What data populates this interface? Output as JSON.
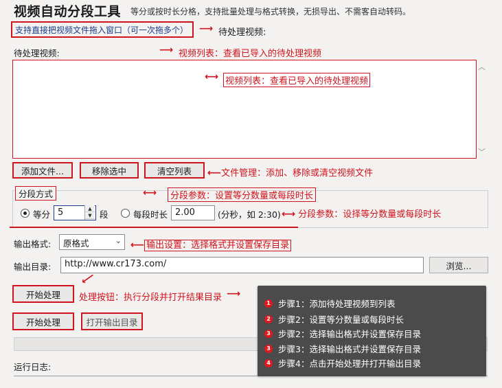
{
  "header": {
    "title": "视频自动分段工具",
    "subtitle": "等分或按时长分格，支持批量处理与格式转换，无损导出、不需客自动转码。"
  },
  "hint": {
    "text": "支持直接把视频文件拖入窗口（可一次拖多个）"
  },
  "annotations": {
    "pending": "待处理视频:",
    "list_top": "视频列表：查看已导入的待处理视频",
    "list_inside": "视频列表：查看已导入的待处理视频",
    "file_mgmt": "文件管理：添加、移除或清空视频文件",
    "split_param_1": "分段参数：设置等分数量或每段时长",
    "split_param_2": "分段参数：设择等分数量或每段时长",
    "output": "输出设置：选择格式并设置保存目录",
    "process": "处理按钮：执行分段并打开结果目录"
  },
  "list": {
    "label": "待处理视频:"
  },
  "file_buttons": {
    "add": "添加文件...",
    "remove": "移除选中",
    "clear": "清空列表"
  },
  "split": {
    "legend": "分段方式",
    "equal_label": "等分",
    "equal_value": "5",
    "equal_unit": "段",
    "duration_label": "每段时长",
    "duration_value": "2.00",
    "duration_hint": "(分秒，如 2:30)"
  },
  "output": {
    "format_label": "输出格式:",
    "format_value": "原格式",
    "dir_label": "输出目录:",
    "dir_value": "http://www.cr173.com/",
    "browse": "浏览..."
  },
  "process": {
    "start": "开始处理",
    "start2": "开始处理",
    "open_dir": "打开输出目录"
  },
  "log": {
    "label": "运行日志:"
  },
  "steps": [
    {
      "n": "1",
      "text": "步骤1：添加待处理视频到列表"
    },
    {
      "n": "2",
      "text": "步骤2：设置等分数量或每段时长"
    },
    {
      "n": "3",
      "text": "步骤2：选择输出格式并设置保存目录"
    },
    {
      "n": "3",
      "text": "步骤3：选择输出格式并设置保存目录"
    },
    {
      "n": "4",
      "text": "步骤4：点击开始处理并打开输出目录"
    }
  ],
  "icons": {
    "arrow_right": "arrow-right-icon",
    "arrow_both": "double-arrow-icon",
    "scroll_up": "scroll-up-icon",
    "scroll_down": "scroll-down-icon",
    "dropdown": "chevron-down-icon"
  },
  "colors": {
    "annotation_red": "#d0141e",
    "tip_bg": "#4b4b4b",
    "hint_blue": "#1b3c8c"
  }
}
